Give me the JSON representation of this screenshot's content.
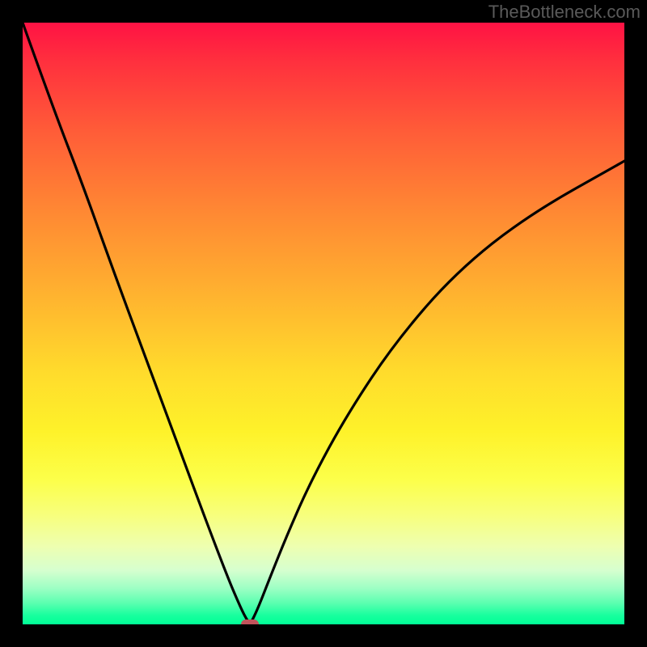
{
  "watermark": "TheBottleneck.com",
  "chart_data": {
    "type": "line",
    "title": "",
    "xlabel": "",
    "ylabel": "",
    "xlim": [
      0,
      100
    ],
    "ylim": [
      0,
      100
    ],
    "grid": false,
    "legend": false,
    "series": [
      {
        "name": "left-branch",
        "x": [
          0,
          5,
          10,
          15,
          20,
          25,
          30,
          34,
          36,
          37,
          37.8
        ],
        "values": [
          100,
          86,
          73,
          59,
          45.5,
          32,
          18.5,
          8,
          3.3,
          1.2,
          0
        ]
      },
      {
        "name": "right-branch",
        "x": [
          37.8,
          39,
          41,
          44,
          48,
          54,
          62,
          72,
          84,
          100
        ],
        "values": [
          0,
          2.4,
          7.5,
          15,
          24,
          35,
          47,
          58.5,
          68,
          77
        ]
      }
    ],
    "marker": {
      "x": 37.8,
      "y": 0,
      "color": "#c1535b"
    },
    "background_gradient": {
      "orientation": "vertical",
      "stops": [
        {
          "pos": 0.0,
          "color": "#ff1244"
        },
        {
          "pos": 0.5,
          "color": "#ffdb2c"
        },
        {
          "pos": 0.8,
          "color": "#fcff4a"
        },
        {
          "pos": 1.0,
          "color": "#00ff96"
        }
      ]
    }
  },
  "colors": {
    "frame": "#000000",
    "curve": "#000000",
    "marker": "#c1535b",
    "watermark": "#5a5a5a"
  }
}
